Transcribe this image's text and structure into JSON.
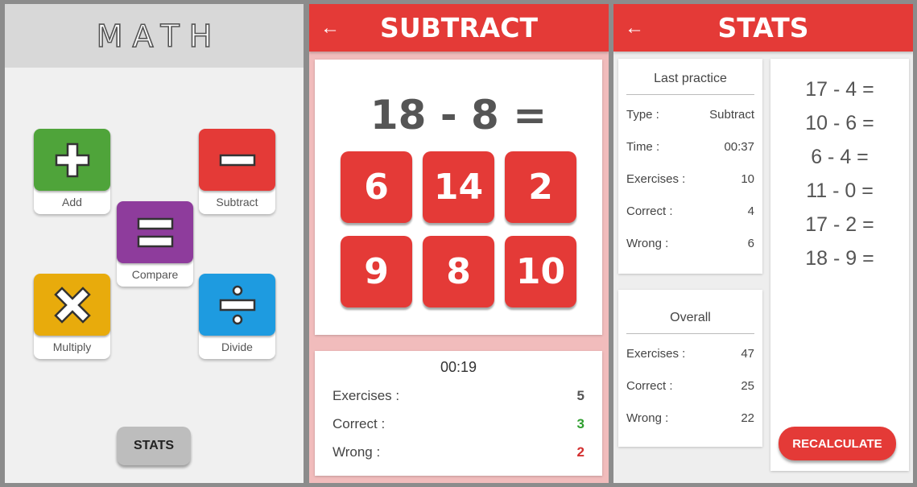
{
  "menu": {
    "title": "MATH",
    "tiles": {
      "add": {
        "label": "Add",
        "color": "#4fa43a"
      },
      "subtract": {
        "label": "Subtract",
        "color": "#e43a37"
      },
      "compare": {
        "label": "Compare",
        "color": "#8e3c9c"
      },
      "multiply": {
        "label": "Multiply",
        "color": "#e8ab0c"
      },
      "divide": {
        "label": "Divide",
        "color": "#1e9be0"
      }
    },
    "stats_button": "STATS"
  },
  "practice": {
    "title": "SUBTRACT",
    "question": "18 - 8 =",
    "answers": [
      "6",
      "14",
      "2",
      "9",
      "8",
      "10"
    ],
    "timer": "00:19",
    "rows": [
      {
        "label": "Exercises :",
        "value": "5",
        "color": "#555555"
      },
      {
        "label": "Correct :",
        "value": "3",
        "color": "#2e9e2e"
      },
      {
        "label": "Wrong :",
        "value": "2",
        "color": "#d32f2f"
      }
    ]
  },
  "stats": {
    "title": "STATS",
    "last_practice": {
      "heading": "Last practice",
      "rows": [
        {
          "label": "Type :",
          "value": "Subtract"
        },
        {
          "label": "Time :",
          "value": "00:37"
        },
        {
          "label": "Exercises :",
          "value": "10"
        },
        {
          "label": "Correct :",
          "value": "4"
        },
        {
          "label": "Wrong :",
          "value": "6"
        }
      ]
    },
    "overall": {
      "heading": "Overall",
      "rows": [
        {
          "label": "Exercises :",
          "value": "47"
        },
        {
          "label": "Correct :",
          "value": "25"
        },
        {
          "label": "Wrong :",
          "value": "22"
        }
      ]
    },
    "equations": [
      "17 - 4 =",
      "10 - 6 =",
      "6 - 4 =",
      "11 - 0 =",
      "17 - 2 =",
      "18 - 9 ="
    ],
    "recalculate_button": "RECALCULATE"
  },
  "icons": {
    "back": "back-arrow-icon",
    "add": "plus-icon",
    "subtract": "minus-icon",
    "compare": "equals-icon",
    "multiply": "times-icon",
    "divide": "divide-icon"
  }
}
